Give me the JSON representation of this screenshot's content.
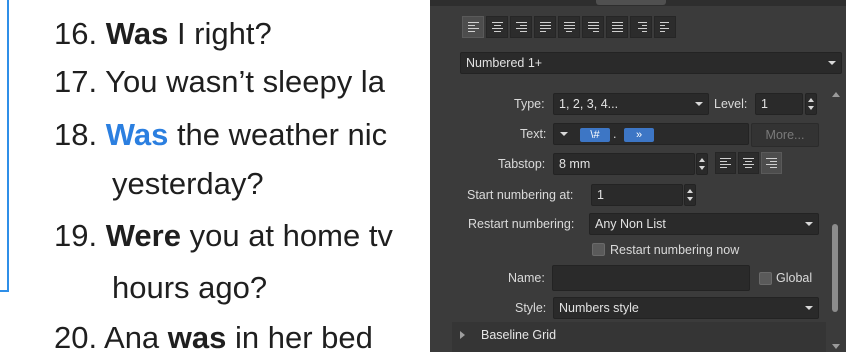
{
  "document": {
    "lines": [
      {
        "num": "16.",
        "bold": "Was",
        "rest": " I right?",
        "blue": ""
      },
      {
        "num": "17.",
        "bold": "",
        "rest": "You wasn’t sleepy la",
        "blue": ""
      },
      {
        "num": "18.",
        "bold": "",
        "rest": " the weather nic",
        "blue": "Was"
      },
      {
        "num": "",
        "bold": "",
        "rest": "yesterday?",
        "blue": ""
      },
      {
        "num": "19.",
        "bold": "Were",
        "rest": " you at home tv",
        "blue": ""
      },
      {
        "num": "",
        "bold": "",
        "rest": "hours ago?",
        "blue": ""
      },
      {
        "num": "20.",
        "bold": "was",
        "rest": " in her bed",
        "pre": "Ana ",
        "blue": ""
      }
    ]
  },
  "panel": {
    "alignment_icons": [
      "align-left-icon",
      "align-center-icon",
      "align-right-icon",
      "justify-left-icon",
      "justify-center-icon",
      "justify-right-icon",
      "justify-all-icon",
      "align-towards-spine-icon",
      "align-away-spine-icon"
    ],
    "list_style": {
      "value": "Numbered 1+"
    },
    "type": {
      "label": "Type:",
      "value": "1, 2, 3, 4..."
    },
    "level": {
      "label": "Level:",
      "value": "1"
    },
    "text": {
      "label": "Text:",
      "token_number": "\\#",
      "separator": ".",
      "token_tab": "»",
      "more_label": "More..."
    },
    "tabstop": {
      "label": "Tabstop:",
      "value": "8 mm"
    },
    "start_numbering": {
      "label": "Start numbering at:",
      "value": "1"
    },
    "restart_numbering": {
      "label": "Restart numbering:",
      "value": "Any Non List"
    },
    "restart_now": {
      "label": "Restart numbering now",
      "checked": false
    },
    "name": {
      "label": "Name:",
      "value": "",
      "global_label": "Global",
      "global_checked": false
    },
    "style": {
      "label": "Style:",
      "value": "Numbers style"
    },
    "baseline_grid": {
      "label": "Baseline Grid"
    }
  },
  "colors": {
    "panel_bg": "#3b3b3b",
    "field_bg": "#2a2a2a",
    "accent": "#3d76c5",
    "doc_highlight": "#2b7fe0"
  }
}
